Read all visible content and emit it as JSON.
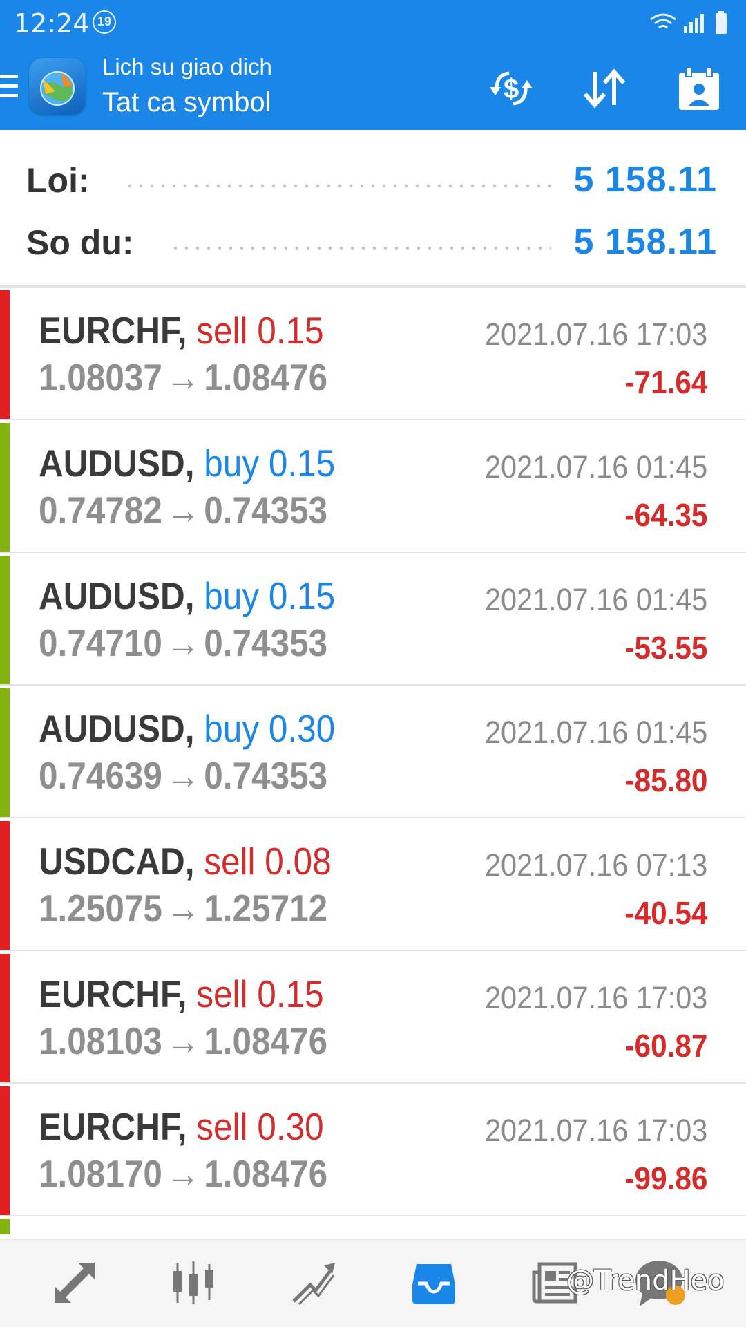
{
  "status_bar": {
    "time": "12:24",
    "notification_count": "19",
    "icons": [
      "wifi-icon",
      "signal-icon",
      "battery-icon"
    ]
  },
  "app_bar": {
    "subtitle": "Lich su giao dich",
    "title": "Tat ca symbol",
    "actions": [
      "currency-exchange-icon",
      "sort-icon",
      "calendar-icon"
    ]
  },
  "summary": {
    "profit_label": "Loi:",
    "profit_value": "5 158.11",
    "balance_label": "So du:",
    "balance_value": "5 158.11"
  },
  "deals": [
    {
      "symbol": "EURCHF,",
      "type": "sell",
      "volume": "0.15",
      "open_price": "1.08037",
      "close_price": "1.08476",
      "time": "2021.07.16 17:03",
      "profit": "-71.64"
    },
    {
      "symbol": "AUDUSD,",
      "type": "buy",
      "volume": "0.15",
      "open_price": "0.74782",
      "close_price": "0.74353",
      "time": "2021.07.16 01:45",
      "profit": "-64.35"
    },
    {
      "symbol": "AUDUSD,",
      "type": "buy",
      "volume": "0.15",
      "open_price": "0.74710",
      "close_price": "0.74353",
      "time": "2021.07.16 01:45",
      "profit": "-53.55"
    },
    {
      "symbol": "AUDUSD,",
      "type": "buy",
      "volume": "0.30",
      "open_price": "0.74639",
      "close_price": "0.74353",
      "time": "2021.07.16 01:45",
      "profit": "-85.80"
    },
    {
      "symbol": "USDCAD,",
      "type": "sell",
      "volume": "0.08",
      "open_price": "1.25075",
      "close_price": "1.25712",
      "time": "2021.07.16 07:13",
      "profit": "-40.54"
    },
    {
      "symbol": "EURCHF,",
      "type": "sell",
      "volume": "0.15",
      "open_price": "1.08103",
      "close_price": "1.08476",
      "time": "2021.07.16 17:03",
      "profit": "-60.87"
    },
    {
      "symbol": "EURCHF,",
      "type": "sell",
      "volume": "0.30",
      "open_price": "1.08170",
      "close_price": "1.08476",
      "time": "2021.07.16 17:03",
      "profit": "-99.86"
    }
  ],
  "bottom_nav": {
    "items": [
      "quotes-icon",
      "chart-icon",
      "trade-icon",
      "history-icon",
      "news-icon",
      "chat-icon"
    ],
    "active": "history-icon",
    "watermark": "@TrendHeo"
  },
  "colors": {
    "accent": "#1a87e8",
    "sell": "#d62b2b",
    "buy_bar": "#82b20e",
    "sell_bar": "#e02020",
    "negative_profit": "#d62b2b"
  }
}
